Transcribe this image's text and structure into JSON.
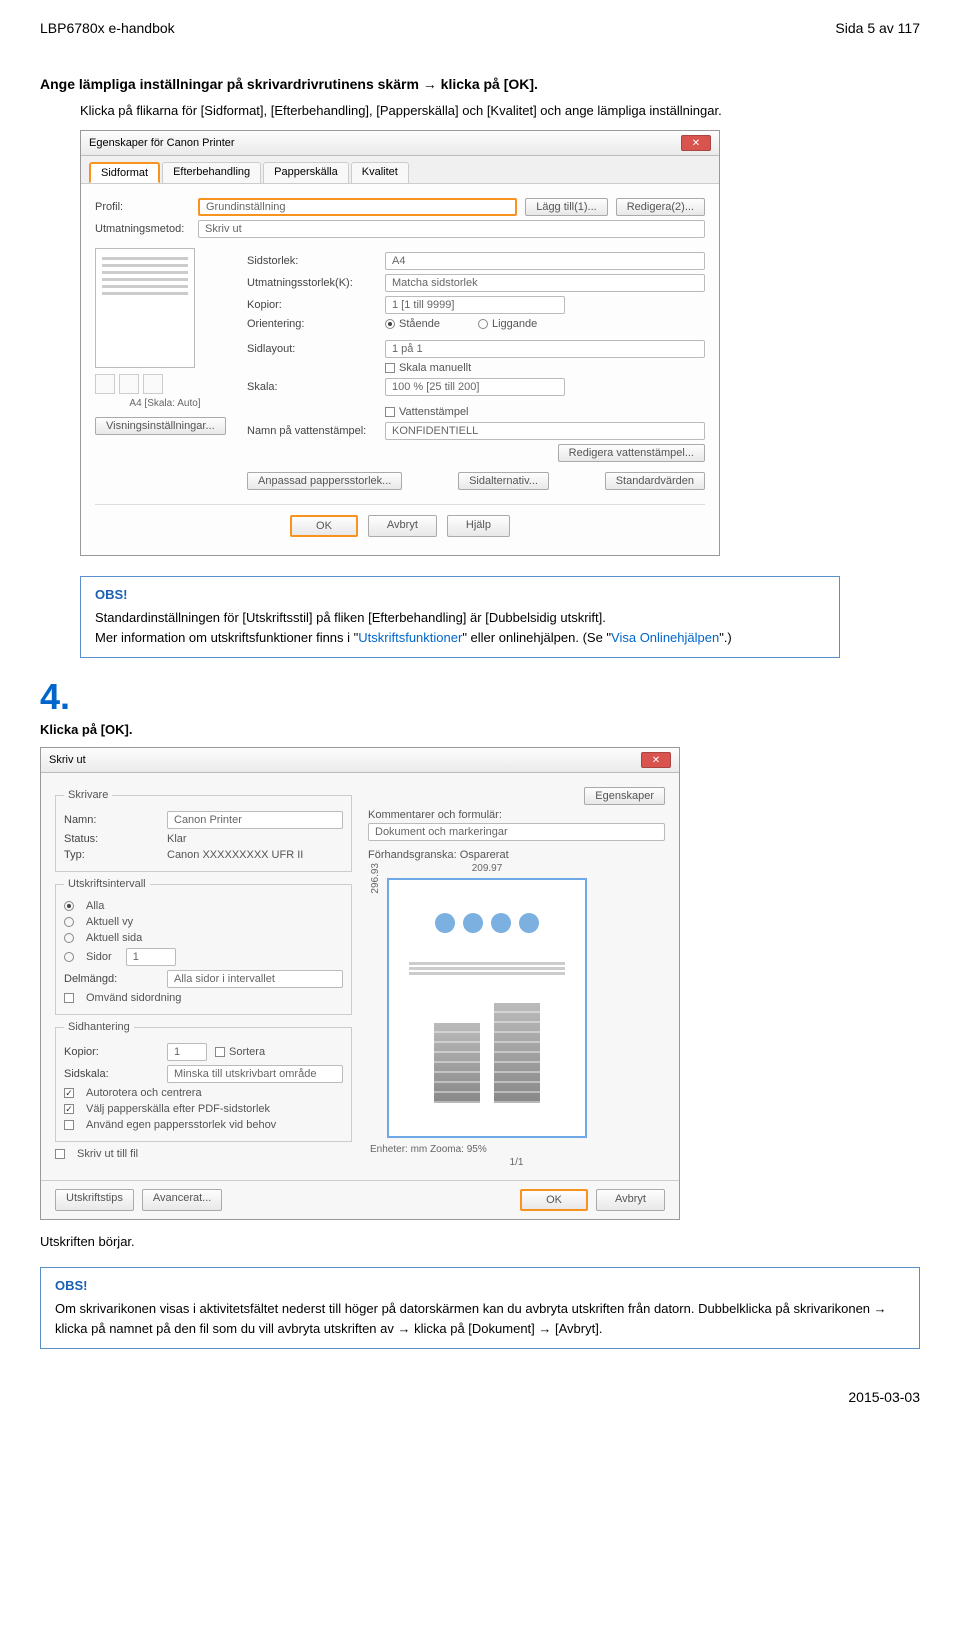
{
  "header": {
    "left": "LBP6780x e-handbok",
    "right": "Sida 5 av 117"
  },
  "section1": {
    "title": "Ange lämpliga inställningar på skrivardrivrutinens skärm → klicka på [OK].",
    "body": "Klicka på flikarna för [Sidformat], [Efterbehandling], [Papperskälla] och [Kvalitet] och ange lämpliga inställningar."
  },
  "dlg1": {
    "title": "Egenskaper för Canon Printer",
    "tabs": [
      "Sidformat",
      "Efterbehandling",
      "Papperskälla",
      "Kvalitet"
    ],
    "profile_label": "Profil:",
    "profile_value": "Grundinställning",
    "btn_add": "Lägg till(1)...",
    "btn_edit": "Redigera(2)...",
    "output_label": "Utmatningsmetod:",
    "output_value": "Skriv ut",
    "thumb_caption": "A4 [Skala: Auto]",
    "btn_view": "Visningsinställningar...",
    "r_size_label": "Sidstorlek:",
    "r_size_value": "A4",
    "r_out_label": "Utmatningsstorlek(K):",
    "r_out_value": "Matcha sidstorlek",
    "r_copies_label": "Kopior:",
    "r_copies_value": "1 [1 till 9999]",
    "r_orient_label": "Orientering:",
    "r_orient_a": "Stående",
    "r_orient_b": "Liggande",
    "r_layout_label": "Sidlayout:",
    "r_layout_value": "1 på 1",
    "chk_scale": "Skala manuellt",
    "r_scale_label": "Skala:",
    "r_scale_value": "100 % [25 till 200]",
    "chk_wm": "Vattenstämpel",
    "r_wm_label": "Namn på vattenstämpel:",
    "r_wm_value": "KONFIDENTIELL",
    "btn_wm_edit": "Redigera vattenstämpel...",
    "btn_custom": "Anpassad pappersstorlek...",
    "btn_pageopts": "Sidalternativ...",
    "btn_defaults": "Standardvärden",
    "btn_ok": "OK",
    "btn_cancel": "Avbryt",
    "btn_help": "Hjälp"
  },
  "note1": {
    "title": "OBS!",
    "line1": "Standardinställningen för [Utskriftsstil] på fliken [Efterbehandling] är [Dubbelsidig utskrift].",
    "line2a": "Mer information om utskriftsfunktioner finns i \"",
    "link1": "Utskriftsfunktioner",
    "line2b": "\" eller onlinehjälpen. (Se \"",
    "link2": "Visa Onlinehjälpen",
    "line2c": "\".)"
  },
  "step4": {
    "num": "4.",
    "label": "Klicka på [OK]."
  },
  "dlg2": {
    "title": "Skriv ut",
    "printer_legend": "Skrivare",
    "printer_name_label": "Namn:",
    "printer_name_value": "Canon Printer",
    "btn_props": "Egenskaper",
    "status_label": "Status:",
    "status_value": "Klar",
    "type_label": "Typ:",
    "type_value": "Canon XXXXXXXXX UFR II",
    "comments_label": "Kommentarer och formulär:",
    "comments_value": "Dokument och markeringar",
    "range_legend": "Utskriftsintervall",
    "range_all": "Alla",
    "range_cur": "Aktuell vy",
    "range_page": "Aktuell sida",
    "range_pages_lbl": "Sidor",
    "range_pages_val": "1",
    "range_subset_lbl": "Delmängd:",
    "range_subset_val": "Alla sidor i intervallet",
    "chk_reverse": "Omvänd sidordning",
    "handling_legend": "Sidhantering",
    "copies_lbl": "Kopior:",
    "copies_val": "1",
    "chk_collate": "Sortera",
    "scale_lbl": "Sidskala:",
    "scale_val": "Minska till utskrivbart område",
    "chk_autorot": "Autorotera och centrera",
    "chk_choose": "Välj papperskälla efter PDF-sidstorlek",
    "chk_custom": "Använd egen pappersstorlek vid behov",
    "chk_tofile": "Skriv ut till fil",
    "preview_legend": "Förhandsgranska: Osparerat",
    "dim_w": "209.97",
    "dim_h": "296.93",
    "units": "Enheter: mm  Zooma: 95%",
    "pager": "1/1",
    "btn_tips": "Utskriftstips",
    "btn_adv": "Avancerat...",
    "btn_ok": "OK",
    "btn_cancel": "Avbryt"
  },
  "after2": "Utskriften börjar.",
  "note2": {
    "title": "OBS!",
    "body": "Om skrivarikonen visas i aktivitetsfältet nederst till höger på datorskärmen kan du avbryta utskriften från datorn. Dubbelklicka på skrivarikonen → klicka på namnet på den fil som du vill avbryta utskriften av → klicka på [Dokument] → [Avbryt]."
  },
  "footer": {
    "date": "2015-03-03"
  }
}
